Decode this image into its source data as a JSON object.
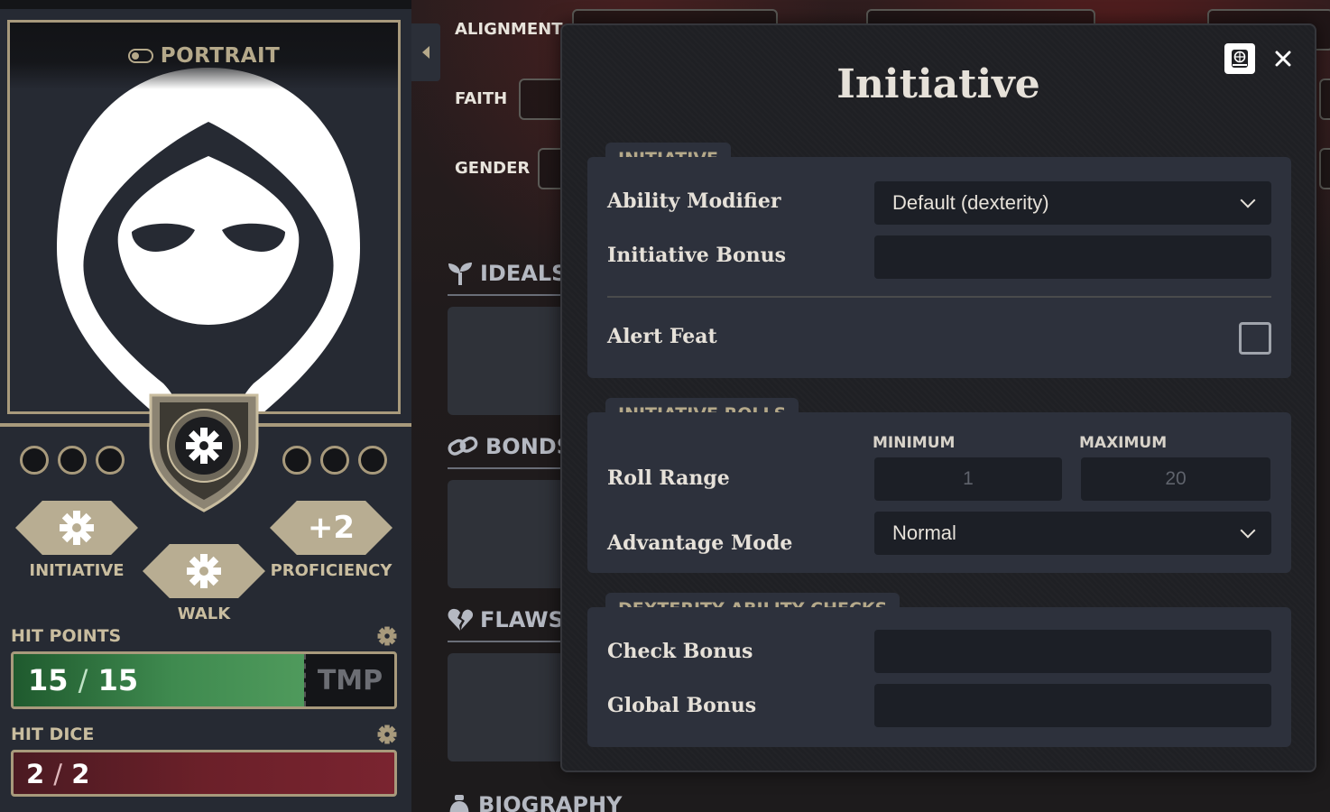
{
  "portrait": {
    "label": "PORTRAIT"
  },
  "attributes": {
    "initiative_label": "INITIATIVE",
    "walk_label": "WALK",
    "proficiency_label": "PROFICIENCY",
    "proficiency_value": "+2"
  },
  "hit_points": {
    "label": "HIT POINTS",
    "current": "15",
    "separator": "/",
    "max": "15",
    "tmp_placeholder": "TMP",
    "fill_fraction": 1.0
  },
  "hit_dice": {
    "label": "HIT DICE",
    "current": "2",
    "separator": "/",
    "max": "2"
  },
  "details": {
    "alignment_label": "ALIGNMENT",
    "faith_label": "FAITH",
    "gender_label": "GENDER"
  },
  "sections": {
    "ideals": "IDEALS",
    "bonds": "BONDS",
    "flaws": "FLAWS",
    "biography": "BIOGRAPHY"
  },
  "modal": {
    "title": "Initiative",
    "initiative": {
      "heading": "INITIATIVE",
      "ability_modifier_label": "Ability Modifier",
      "ability_modifier_value": "Default (dexterity)",
      "initiative_bonus_label": "Initiative Bonus",
      "initiative_bonus_value": "",
      "alert_feat_label": "Alert Feat",
      "alert_feat_checked": false
    },
    "rolls": {
      "heading": "INITIATIVE ROLLS",
      "minimum_label": "MINIMUM",
      "maximum_label": "MAXIMUM",
      "roll_range_label": "Roll Range",
      "minimum_placeholder": "1",
      "maximum_placeholder": "20",
      "advantage_mode_label": "Advantage Mode",
      "advantage_mode_value": "Normal"
    },
    "dex_checks": {
      "heading": "DEXTERITY ABILITY CHECKS",
      "check_bonus_label": "Check Bonus",
      "check_bonus_value": "",
      "global_bonus_label": "Global Bonus",
      "global_bonus_value": ""
    }
  },
  "colors": {
    "accent_gold": "#a89a7c",
    "hp_green": "#3f8a4f",
    "hit_dice_red": "#6b2029",
    "panel_bg": "#2d313c"
  }
}
